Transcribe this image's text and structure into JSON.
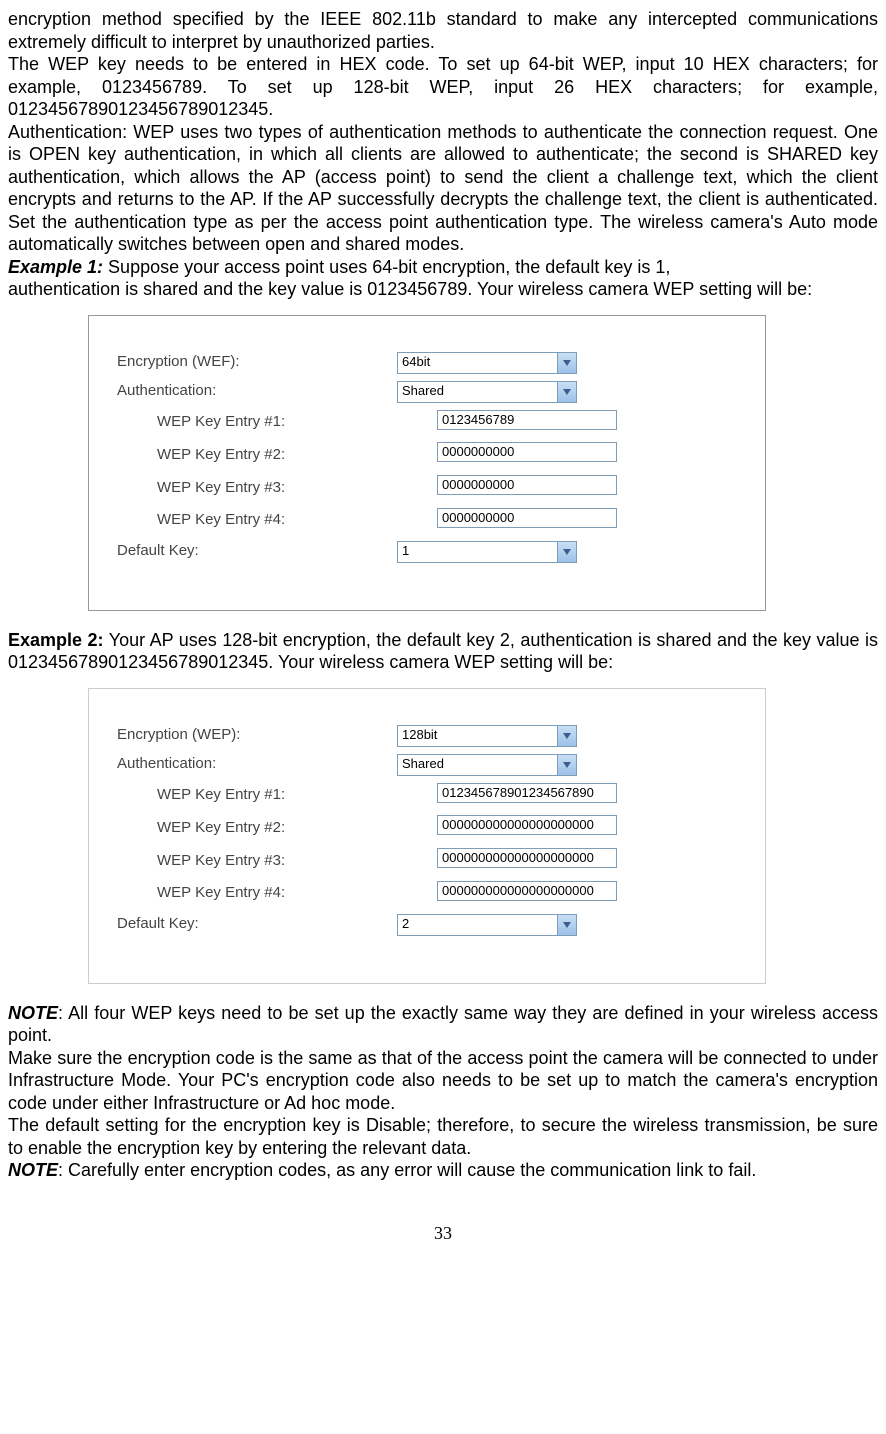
{
  "intro": {
    "p1": "encryption method specified by the IEEE 802.11b standard to make any intercepted communications extremely difficult to interpret by unauthorized parties.",
    "p2": "The WEP key needs to be entered in HEX code. To set up 64-bit WEP, input 10 HEX characters; for example, 0123456789. To set up 128-bit WEP, input 26 HEX characters; for example, 01234567890123456789012345.",
    "p3": "Authentication: WEP uses two types of authentication methods to authenticate the connection request. One is OPEN key authentication, in which all clients are allowed to authenticate; the second is SHARED key authentication, which allows the AP (access point) to send the client a challenge text, which the client encrypts and returns to the AP. If the AP successfully decrypts the challenge text, the client is authenticated. Set the authentication type as per the access point authentication type. The wireless camera's Auto mode automatically switches between open and shared modes."
  },
  "example1": {
    "label": "Example 1:",
    "text1": " Suppose your access point uses 64-bit encryption, the default key is 1,",
    "text2": "authentication is shared and the key value is 0123456789. Your wireless camera WEP setting will be:"
  },
  "panel1": {
    "encryption_label": "Encryption (WEF):",
    "encryption_value": "64bit",
    "auth_label": "Authentication:",
    "auth_value": "Shared",
    "wep1_label": "WEP Key Entry #1:",
    "wep1_value": "0123456789",
    "wep2_label": "WEP Key Entry #2:",
    "wep2_value": "0000000000",
    "wep3_label": "WEP Key Entry #3:",
    "wep3_value": "0000000000",
    "wep4_label": "WEP Key Entry #4:",
    "wep4_value": "0000000000",
    "default_label": "Default Key:",
    "default_value": "1"
  },
  "example2": {
    "label": "Example 2:",
    "text": " Your AP uses 128-bit encryption, the default key 2, authentication is shared and the key value is 01234567890123456789012345. Your wireless camera WEP setting will be:"
  },
  "panel2": {
    "encryption_label": "Encryption (WEP):",
    "encryption_value": "128bit",
    "auth_label": "Authentication:",
    "auth_value": "Shared",
    "wep1_label": "WEP Key Entry #1:",
    "wep1_value": "012345678901234567890",
    "wep2_label": "WEP Key Entry #2:",
    "wep2_value": "000000000000000000000",
    "wep3_label": "WEP Key Entry #3:",
    "wep3_value": "000000000000000000000",
    "wep4_label": "WEP Key Entry #4:",
    "wep4_value": "000000000000000000000",
    "default_label": "Default Key:",
    "default_value": "2"
  },
  "notes": {
    "note_label": "NOTE",
    "n1": ": All four WEP keys need to be set up the exactly same way they are defined in your wireless access point.",
    "n2": "Make sure the encryption code is the same as that of the access point the camera will be connected to under Infrastructure Mode. Your PC's encryption code also needs to be set up to match the camera's encryption code under either Infrastructure or Ad hoc mode.",
    "n3": "The default setting for the encryption key is Disable; therefore, to secure the wireless transmission, be sure to enable the encryption key by entering the relevant data.",
    "n4": ": Carefully enter encryption codes, as any error will cause the communication link to fail."
  },
  "page_number": "33"
}
